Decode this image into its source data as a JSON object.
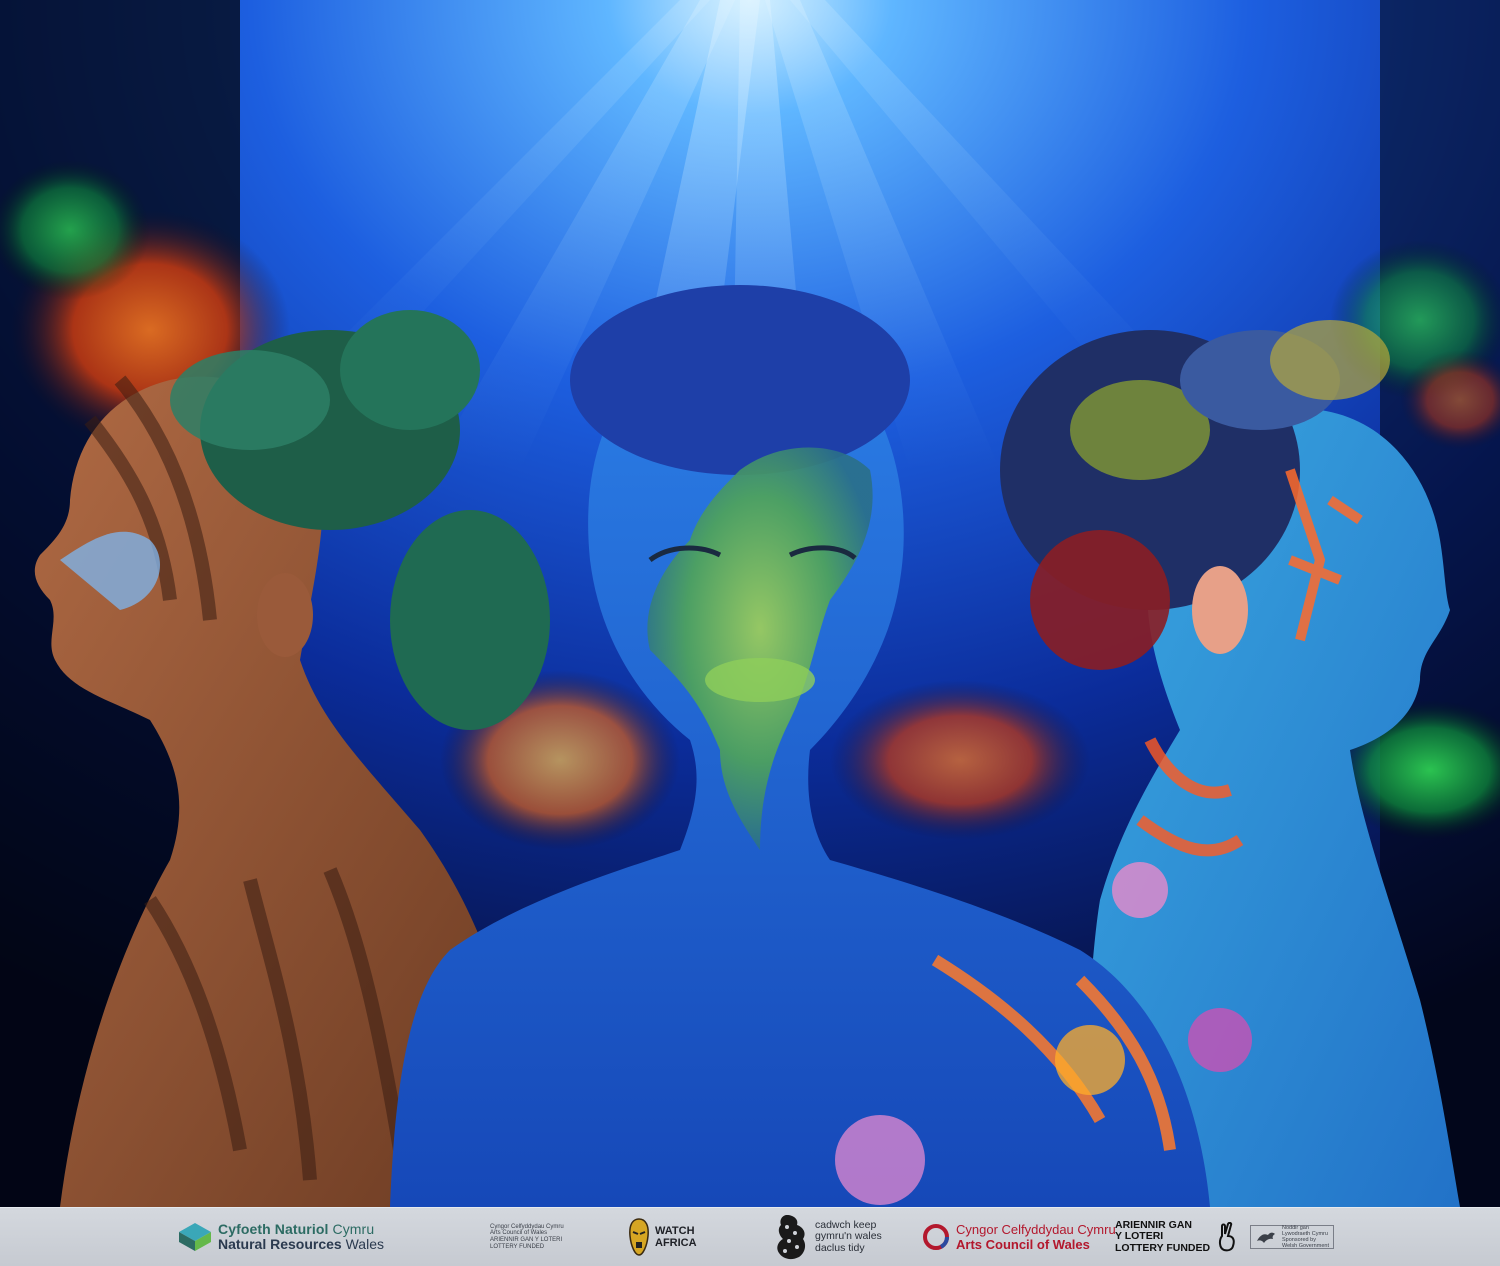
{
  "image": {
    "scene": "underwater-body-paint-portrait",
    "colors": {
      "water_deep": "#0a1a6b",
      "water_light": "#2a78ff",
      "light_rays": "#bfe6ff",
      "left_paint": "#8a4a2a",
      "center_paint": "#1c5fd0",
      "right_paint": "#3aa8e0",
      "hair_green": "#1f6a52",
      "strip_bg": "#cdd1d8"
    }
  },
  "logos": {
    "nrw": {
      "line1_bold": "Cyfoeth Naturiol",
      "line1_lite": " Cymru",
      "line2_bold": "Natural Resources",
      "line2_lite": " Wales"
    },
    "acw_small": {
      "line1": "Cyngor Celfyddydau Cymru",
      "line2": "Arts Council of Wales",
      "line3": "ARIENNIR GAN Y LOTERI",
      "line4": "LOTTERY FUNDED"
    },
    "watch_africa": {
      "line1": "WATCH",
      "line2": "AFRICA"
    },
    "keep_wales_tidy": {
      "line1": "cadwch keep",
      "line2": "gymru'n wales",
      "line3": "daclus tidy"
    },
    "acw": {
      "line1": "Cyngor Celfyddydau Cymru",
      "line2": "Arts Council of Wales"
    },
    "lottery": {
      "line1": "ARIENNIR GAN",
      "line2": "Y LOTERI",
      "line3": "LOTTERY FUNDED"
    },
    "welsh_gov": {
      "line1": "Noddir gan",
      "line2": "Lywodraeth Cymru",
      "line3": "Sponsored by",
      "line4": "Welsh Government"
    }
  }
}
